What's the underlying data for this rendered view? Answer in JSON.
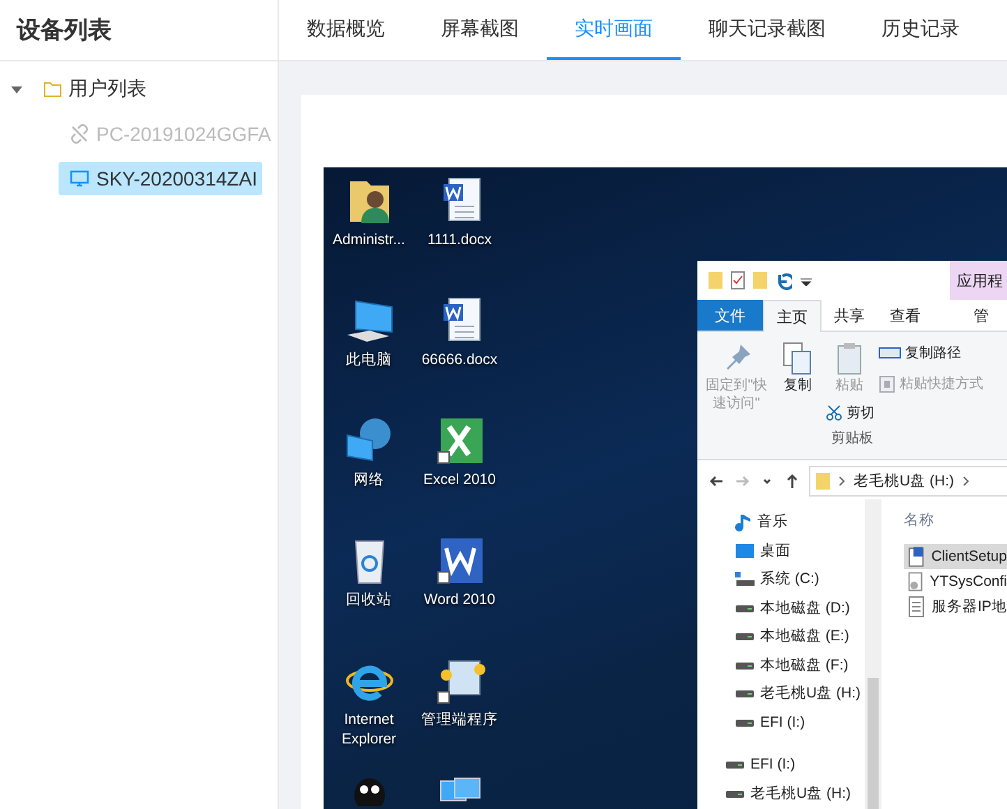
{
  "sidebar": {
    "title": "设备列表",
    "tree": [
      {
        "label": "用户列表",
        "expanded": true,
        "children": [
          {
            "label": "PC-20191024GGFA",
            "online": false,
            "selected": false
          },
          {
            "label": "SKY-20200314ZAI",
            "online": true,
            "selected": true
          }
        ]
      }
    ]
  },
  "tabs": [
    {
      "label": "数据概览",
      "selected": false
    },
    {
      "label": "屏幕截图",
      "selected": false
    },
    {
      "label": "实时画面",
      "selected": true
    },
    {
      "label": "聊天记录截图",
      "selected": false
    },
    {
      "label": "历史记录",
      "selected": false
    }
  ],
  "live_view": {
    "desktop_icons": [
      {
        "label": "Administr...",
        "kind": "user-folder"
      },
      {
        "label": "1111.docx",
        "kind": "word-doc"
      },
      {
        "label": "此电脑",
        "kind": "computer"
      },
      {
        "label": "66666.docx",
        "kind": "word-doc"
      },
      {
        "label": "网络",
        "kind": "network"
      },
      {
        "label": "Excel 2010",
        "kind": "excel"
      },
      {
        "label": "回收站",
        "kind": "recycle-bin"
      },
      {
        "label": "Word 2010",
        "kind": "word"
      },
      {
        "label": "Internet Explorer",
        "kind": "ie"
      },
      {
        "label": "管理端程序",
        "kind": "app"
      },
      {
        "kind": "penguin"
      },
      {
        "kind": "network-computer"
      }
    ],
    "explorer": {
      "context_tab": "应用程",
      "ribbon_tabs": [
        {
          "label": "文件",
          "kind": "file",
          "selected": false
        },
        {
          "label": "主页",
          "kind": "tab",
          "selected": true
        },
        {
          "label": "共享",
          "kind": "tab",
          "selected": false
        },
        {
          "label": "查看",
          "kind": "tab",
          "selected": false
        },
        {
          "label": "管",
          "kind": "context",
          "selected": false
        }
      ],
      "ribbon_group": {
        "label": "剪贴板",
        "columns": [
          [
            {
              "label": "固定到\"快速访问\"",
              "kind": "pin",
              "disabled": true
            }
          ],
          [
            {
              "label": "复制",
              "kind": "copy",
              "disabled": false
            }
          ],
          [
            {
              "label": "粘贴",
              "kind": "paste",
              "disabled": true
            },
            {
              "label": "剪切",
              "kind": "cut",
              "disabled": false
            }
          ],
          [
            {
              "label": "复制路径",
              "kind": "copy-path",
              "disabled": false
            },
            {
              "label": "粘贴快捷方式",
              "kind": "paste-shortcut",
              "disabled": true
            }
          ]
        ]
      },
      "nav_buttons": [
        {
          "kind": "back",
          "disabled": false
        },
        {
          "kind": "forward",
          "disabled": true
        },
        {
          "kind": "recent",
          "disabled": false
        },
        {
          "kind": "up",
          "disabled": false
        }
      ],
      "path": [
        "老毛桃U盘 (H:)"
      ],
      "nav_items": [
        {
          "label": "音乐",
          "kind": "music"
        },
        {
          "label": "桌面",
          "kind": "desktop"
        },
        {
          "label": "系统 (C:)",
          "kind": "system-drive"
        },
        {
          "label": "本地磁盘 (D:)",
          "kind": "drive"
        },
        {
          "label": "本地磁盘 (E:)",
          "kind": "drive"
        },
        {
          "label": "本地磁盘 (F:)",
          "kind": "drive"
        },
        {
          "label": "老毛桃U盘 (H:)",
          "kind": "drive"
        },
        {
          "label": "EFI (I:)",
          "kind": "drive"
        }
      ],
      "root_nav_items": [
        {
          "label": "EFI (I:)",
          "kind": "drive"
        },
        {
          "label": "老毛桃U盘 (H:)",
          "kind": "drive"
        }
      ],
      "column_header": "名称",
      "files": [
        {
          "label": "ClientSetup",
          "kind": "installer",
          "selected": true
        },
        {
          "label": "YTSysConfi",
          "kind": "config",
          "selected": false
        },
        {
          "label": "服务器IP地",
          "kind": "text",
          "selected": false
        }
      ]
    }
  }
}
